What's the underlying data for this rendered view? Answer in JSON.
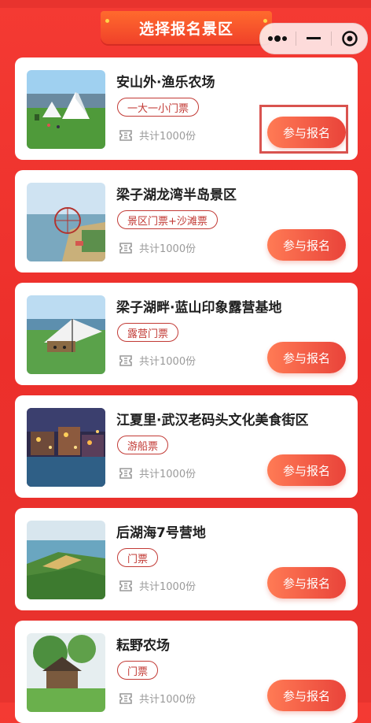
{
  "header": {
    "title": "选择报名景区"
  },
  "capsule": {
    "more": "more-icon",
    "minimize": "minimize-icon",
    "close": "close-icon"
  },
  "items": [
    {
      "name": "安山外·渔乐农场",
      "tag": "一大一小门票",
      "count": "共计1000份",
      "button": "参与报名"
    },
    {
      "name": "梁子湖龙湾半岛景区",
      "tag": "景区门票+沙滩票",
      "count": "共计1000份",
      "button": "参与报名"
    },
    {
      "name": "梁子湖畔·蓝山印象露营基地",
      "tag": "露营门票",
      "count": "共计1000份",
      "button": "参与报名"
    },
    {
      "name": "江夏里·武汉老码头文化美食街区",
      "tag": "游船票",
      "count": "共计1000份",
      "button": "参与报名"
    },
    {
      "name": "后湖海7号营地",
      "tag": "门票",
      "count": "共计1000份",
      "button": "参与报名"
    },
    {
      "name": "耘野农场",
      "tag": "门票",
      "count": "共计1000份",
      "button": "参与报名"
    }
  ],
  "colors": {
    "accent": "#e9433a",
    "tag": "#c23a35",
    "background": "#ec2f2b"
  }
}
